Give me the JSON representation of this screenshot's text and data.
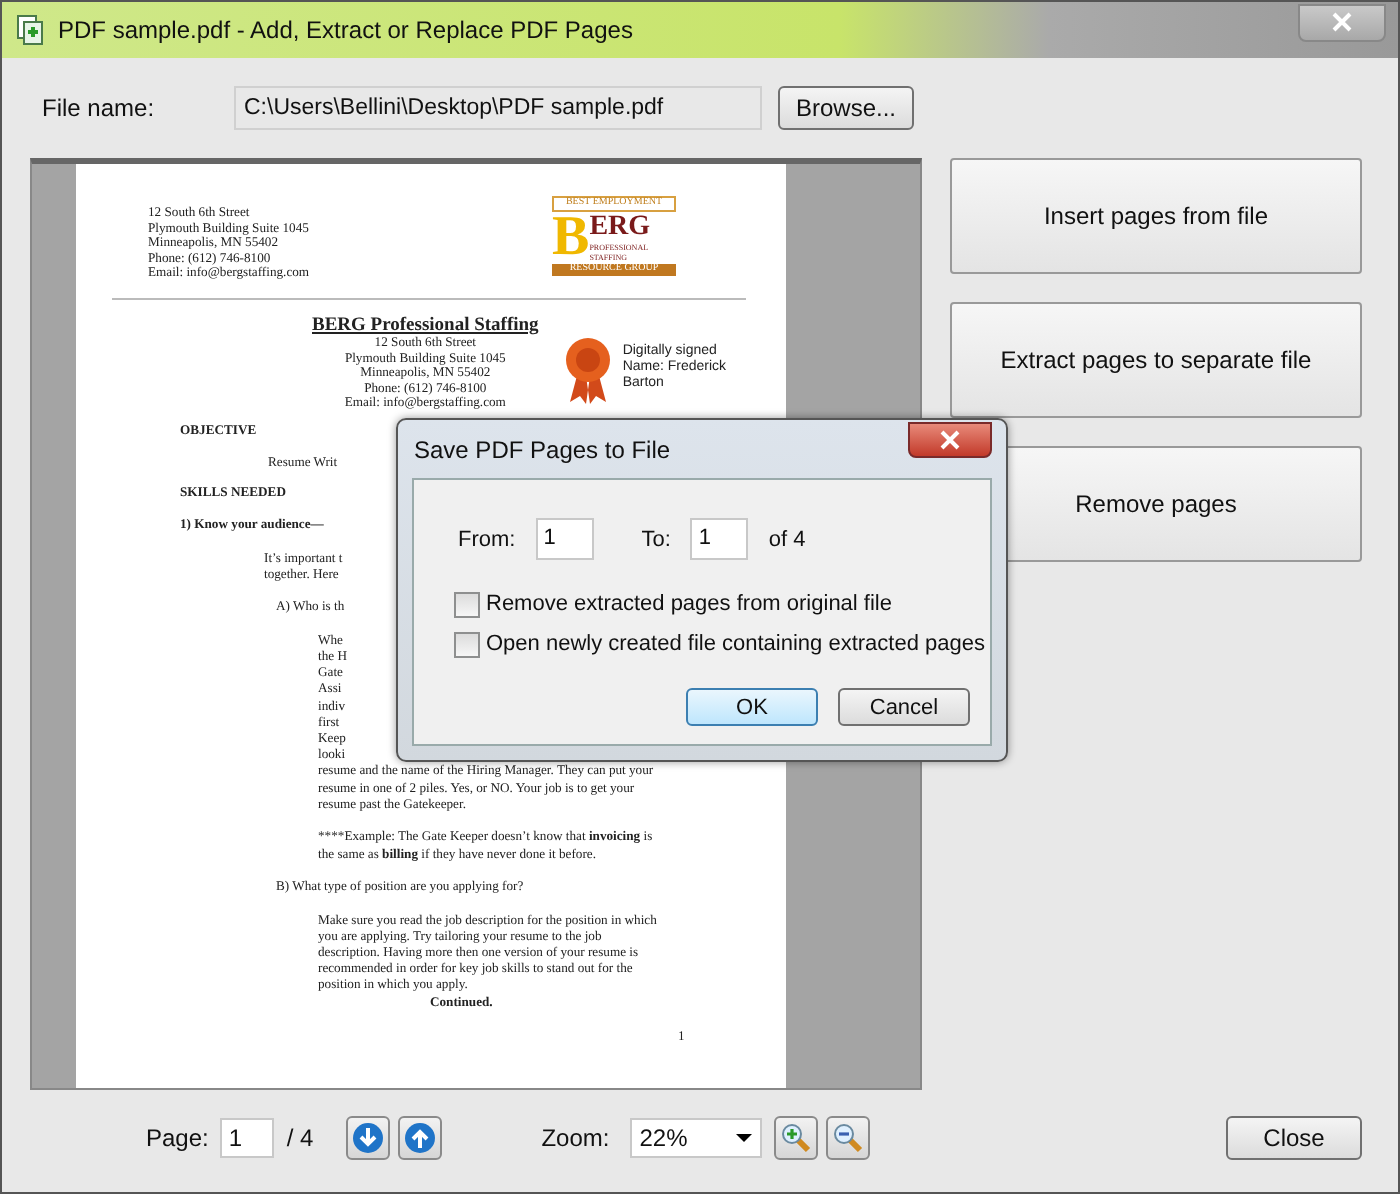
{
  "window": {
    "title": "PDF sample.pdf - Add, Extract or Replace PDF Pages"
  },
  "file": {
    "label": "File name:",
    "value": "C:\\Users\\Bellini\\Desktop\\PDF sample.pdf",
    "browse": "Browse..."
  },
  "document": {
    "sender_address": [
      "12 South 6th Street",
      "Plymouth Building Suite 1045",
      "Minneapolis, MN 55402",
      "Phone: (612) 746-8100",
      "Email: info@bergstaffing.com"
    ],
    "logo": {
      "top": "BEST EMPLOYMENT",
      "initial": "B",
      "name": "ERG",
      "sub": "PROFESSIONAL STAFFING",
      "bottom": "RESOURCE GROUP"
    },
    "heading": "BERG Professional Staffing",
    "heading_address": [
      "12 South 6th Street",
      "Plymouth Building Suite 1045",
      "Minneapolis, MN 55402",
      "Phone: (612) 746-8100",
      "Email: info@bergstaffing.com"
    ],
    "signature": [
      "Digitally signed",
      "Name: Frederick",
      "Barton"
    ],
    "blocks": [
      {
        "kind": "section",
        "lines": [
          "OBJECTIVE"
        ]
      },
      {
        "kind": "objective",
        "lines": [
          "Resume Writ"
        ]
      },
      {
        "kind": "section",
        "lines": [
          "SKILLS NEEDED"
        ]
      },
      {
        "kind": "item",
        "lines": [
          "1)  Know your audience—"
        ]
      },
      {
        "kind": "para",
        "lines": [
          "It’s important t",
          "together. Here"
        ]
      },
      {
        "kind": "sub",
        "lines": [
          "A)  Who is th"
        ]
      },
      {
        "kind": "subpara",
        "lines": [
          "Whe",
          "the H",
          "Gate",
          "Assi",
          "indiv",
          "first",
          "Keep",
          "looki",
          "resume and the name of the Hiring Manager. They can put your",
          "resume in one of 2 piles. Yes, or NO. Your job is to get your",
          "resume past the Gatekeeper."
        ]
      },
      {
        "kind": "subpara",
        "lines": [
          [
            {
              "text": "****Example: The Gate Keeper doesn’t know that ",
              "bold": false
            },
            {
              "text": "invoicing",
              "bold": true
            },
            {
              "text": " is",
              "bold": false
            }
          ],
          "the same as **billing** if they have never done it before."
        ]
      },
      {
        "kind": "sub",
        "lines": [
          "B)  What type of position are you applying for?"
        ]
      },
      {
        "kind": "subpara",
        "lines": [
          "Make sure you read the job description for the position in which",
          "you are applying. Try tailoring your resume to the job",
          "description. Having more then one version of your resume is",
          "recommended in order for key job skills to stand out for the",
          "position in which you apply."
        ]
      },
      {
        "kind": "continued",
        "lines": [
          "Continued."
        ]
      },
      {
        "kind": "pagenum",
        "lines": [
          "1"
        ]
      }
    ]
  },
  "actions": [
    "Insert pages from file",
    "Extract pages to separate file",
    "Remove pages"
  ],
  "pager": {
    "label": "Page:",
    "value": "1",
    "total": "/ 4"
  },
  "zoom": {
    "label": "Zoom:",
    "value": "22%"
  },
  "close": "Close",
  "dialog": {
    "title": "Save PDF Pages to File",
    "from_label": "From:",
    "from": "1",
    "to_label": "To:",
    "to": "1",
    "of": "of 4",
    "options": [
      {
        "label": "Remove extracted pages from original file",
        "checked": false
      },
      {
        "label": "Open newly created file containing extracted pages",
        "checked": false
      }
    ],
    "ok": "OK",
    "cancel": "Cancel"
  }
}
